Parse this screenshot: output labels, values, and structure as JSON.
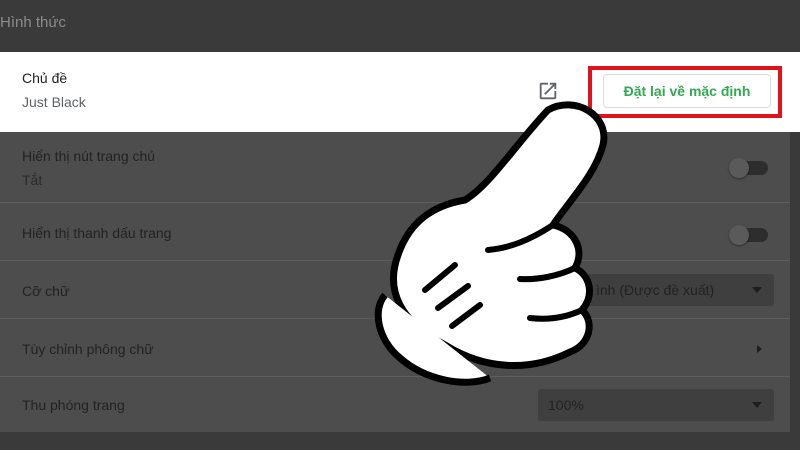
{
  "section": {
    "title": "Hình thức"
  },
  "theme": {
    "label": "Chủ đề",
    "value": "Just Black",
    "reset_button_label": "Đặt lại về mặc định",
    "external_link_icon": "open-in-new-icon"
  },
  "settings": {
    "show_home_button": {
      "label": "Hiển thị nút trang chủ",
      "status": "Tắt",
      "enabled": false
    },
    "show_bookmarks_bar": {
      "label": "Hiển thị thanh dấu trang",
      "enabled": false
    },
    "font_size": {
      "label": "Cỡ chữ",
      "selected_value": "ình (Được đề xuất)"
    },
    "customize_fonts": {
      "label": "Tùy chỉnh phông chữ"
    },
    "page_zoom": {
      "label": "Thu phóng trang",
      "selected_value": "100%"
    }
  },
  "colors": {
    "highlight": "#e0121b",
    "reset_text": "#34a853",
    "overlay_background": "#4d4d4d"
  }
}
